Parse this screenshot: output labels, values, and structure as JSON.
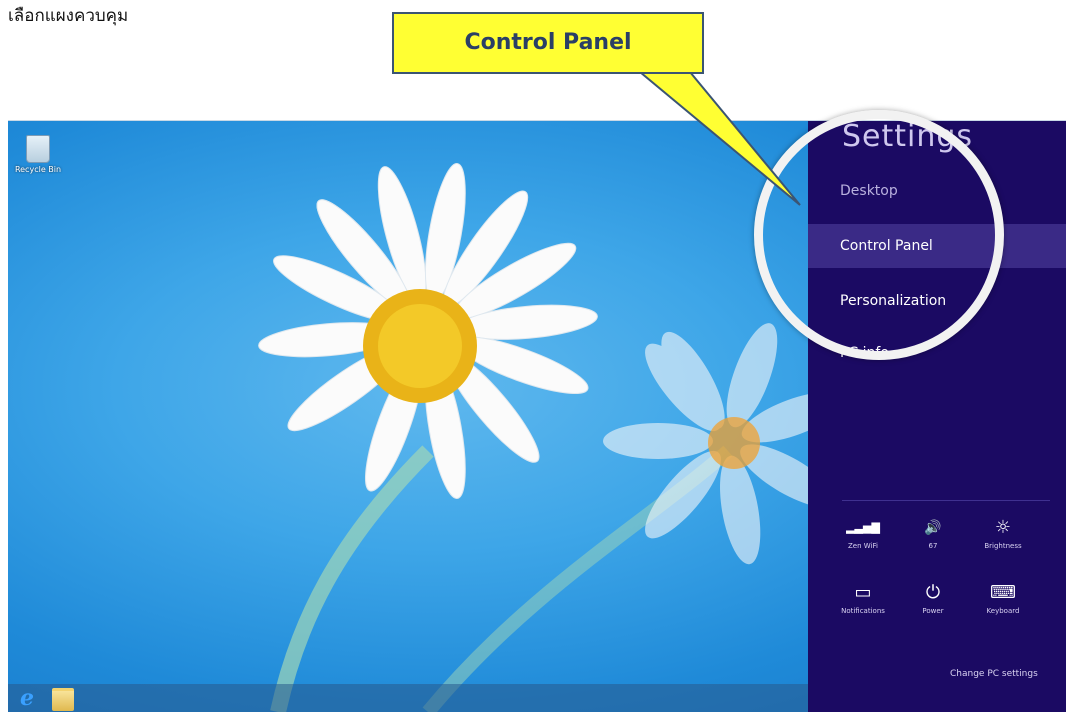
{
  "caption": "เลือกแผงควบคุม",
  "callout": {
    "label": "Control Panel"
  },
  "desktop": {
    "icons": [
      {
        "label": "Recycle Bin",
        "icon": "recycle-bin-icon"
      }
    ]
  },
  "taskbar": {
    "items": [
      {
        "icon": "internet-explorer-icon"
      },
      {
        "icon": "file-explorer-icon"
      }
    ]
  },
  "charm": {
    "title": "Settings",
    "items": [
      {
        "label": "Desktop",
        "state": "dim"
      },
      {
        "label": "Control Panel",
        "state": "selected"
      },
      {
        "label": "Personalization",
        "state": "normal"
      },
      {
        "label": "PC info",
        "state": "normal"
      }
    ],
    "quick": [
      {
        "label": "Zen WiFi",
        "icon": "wifi-signal-icon",
        "glyph": "▂▃▅▇"
      },
      {
        "label": "67",
        "icon": "volume-icon",
        "glyph": "🔊"
      },
      {
        "label": "Brightness",
        "icon": "brightness-icon",
        "glyph": "☼"
      },
      {
        "label": "Notifications",
        "icon": "notifications-icon",
        "glyph": "▭"
      },
      {
        "label": "Power",
        "icon": "power-icon",
        "glyph": "⏻"
      },
      {
        "label": "Keyboard",
        "icon": "keyboard-icon",
        "glyph": "⌨"
      }
    ],
    "change_pc": "Change PC settings"
  },
  "colors": {
    "charm_bg": "#1b0a63",
    "desktop_blue": "#3ea6e8",
    "callout_yellow": "#ffff33"
  }
}
